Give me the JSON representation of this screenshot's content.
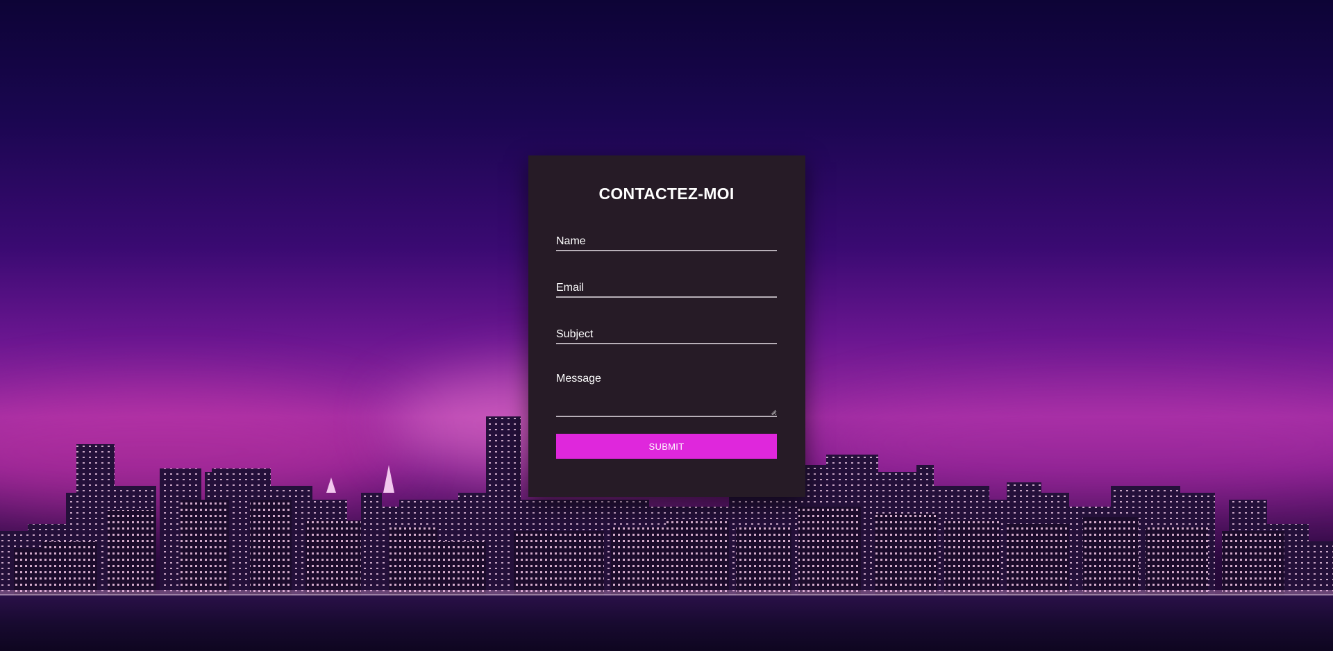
{
  "colors": {
    "card_background": "#261b26",
    "submit_background": "#df27dc",
    "text": "#ffffff",
    "underline": "#b8b0b8"
  },
  "background": {
    "icon": "city-skyline-at-night"
  },
  "form": {
    "title": "CONTACTEZ-MOI",
    "name_placeholder": "Name",
    "email_placeholder": "Email",
    "subject_placeholder": "Subject",
    "message_placeholder": "Message",
    "submit_label": "SUBMIT"
  }
}
